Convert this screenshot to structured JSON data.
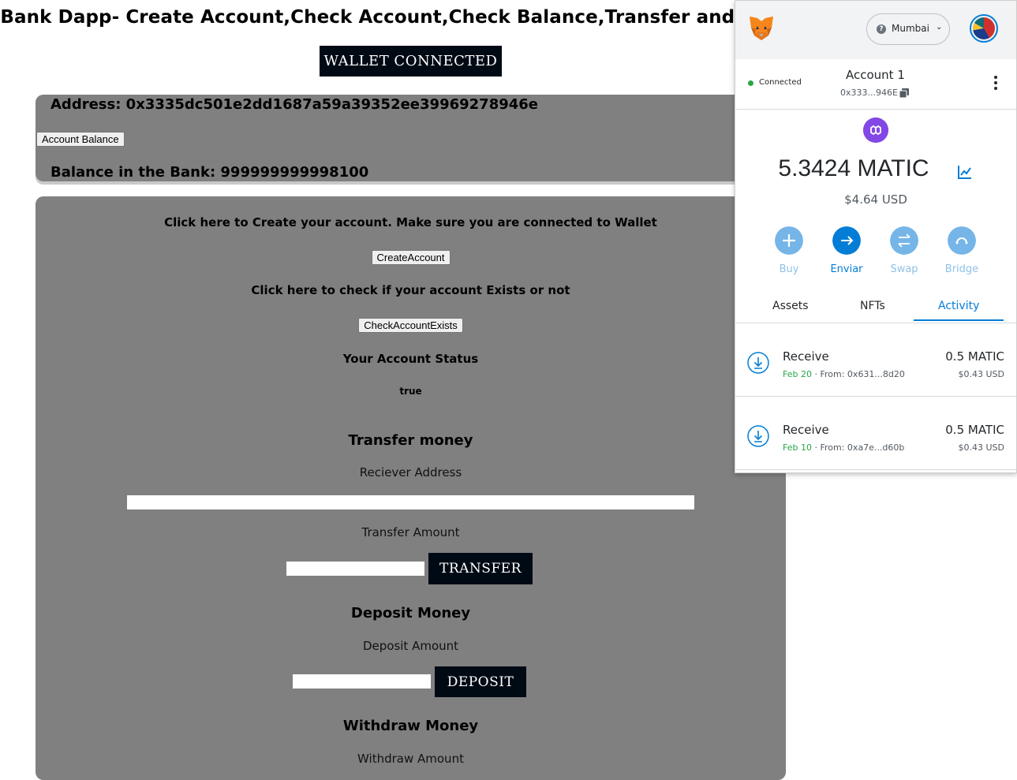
{
  "dapp": {
    "title": "Bank Dapp- Create Account,Check Account,Check Balance,Transfer and Deposit",
    "wallet_button": "WALLET CONNECTED",
    "address_text": "Address: 0x3335dc501e2dd1687a59a39352ee39969278946e",
    "account_balance_button": "Account Balance",
    "balance_text": "Balance in the Bank: 999999999998100",
    "create_prompt": "Click here to Create your account. Make sure you are connected to Wallet",
    "create_button": "CreateAccount",
    "check_prompt": "Click here to check if your account Exists or not",
    "check_button": "CheckAccountExists",
    "status_heading": "Your Account Status",
    "status_value": "true",
    "transfer": {
      "heading": "Transfer money",
      "receiver_label": "Reciever Address",
      "amount_label": "Transfer Amount",
      "button": "TRANSFER"
    },
    "deposit": {
      "heading": "Deposit Money",
      "amount_label": "Deposit Amount",
      "button": "DEPOSIT"
    },
    "withdraw": {
      "heading": "Withdraw Money",
      "amount_label": "Withdraw Amount"
    },
    "colors": {
      "panel": "#808080",
      "dark_button": "#000a14"
    }
  },
  "metamask": {
    "network": "Mumbai",
    "connection_status": "Connected",
    "account_name": "Account 1",
    "account_address": "0x333...946E",
    "balance": "5.3424 MATIC",
    "balance_usd": "$4.64 USD",
    "actions": [
      {
        "label": "Buy",
        "icon": "plus-icon"
      },
      {
        "label": "Enviar",
        "icon": "arrow-right-icon"
      },
      {
        "label": "Swap",
        "icon": "swap-icon"
      },
      {
        "label": "Bridge",
        "icon": "bridge-icon"
      }
    ],
    "tabs": [
      "Assets",
      "NFTs",
      "Activity"
    ],
    "active_tab": "Activity",
    "transactions": [
      {
        "type": "Receive",
        "date": "Feb 20",
        "from": " · From: 0x631...8d20",
        "amount": "0.5 MATIC",
        "usd": "$0.43 USD"
      },
      {
        "type": "Receive",
        "date": "Feb 10",
        "from": " · From: 0xa7e...d60b",
        "amount": "0.5 MATIC",
        "usd": "$0.43 USD"
      }
    ],
    "colors": {
      "primary": "#037dd6",
      "polygon": "#8247e5",
      "success": "#28a745"
    }
  }
}
